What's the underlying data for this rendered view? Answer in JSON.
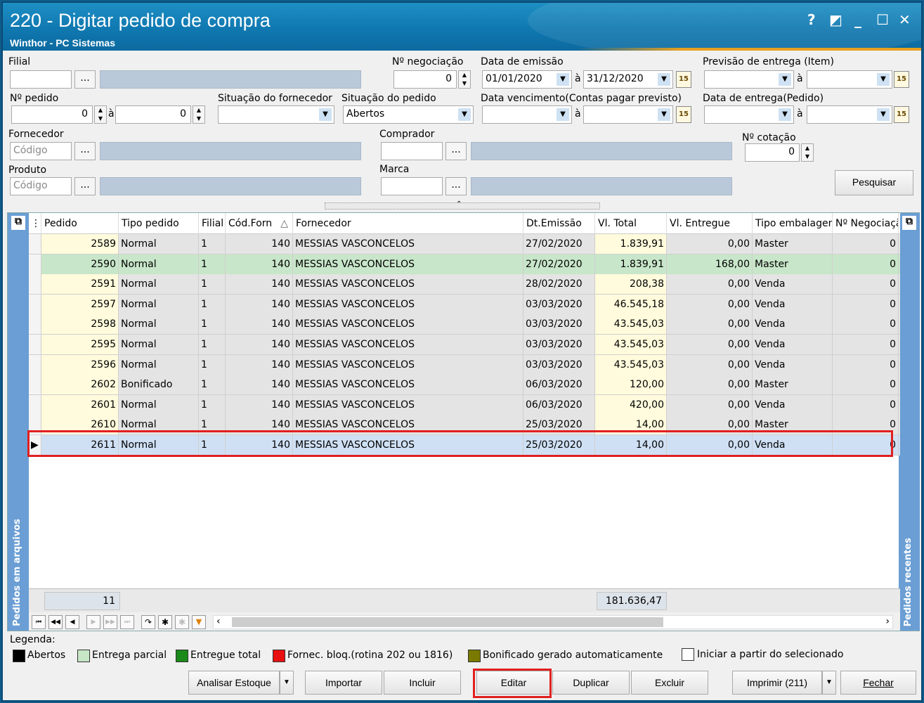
{
  "window": {
    "title": "220 - Digitar pedido de compra",
    "subtitle": "Winthor - PC Sistemas",
    "help": "?",
    "restore": "◩",
    "minimize": "_",
    "maximize": "☐",
    "close": "✕"
  },
  "filters": {
    "filial_label": "Filial",
    "ellipsis": "...",
    "negociacao_label": "Nº negociação",
    "negociacao_value": "0",
    "data_emissao_label": "Data de emissão",
    "data_emissao_from": "01/01/2020",
    "data_emissao_to": "31/12/2020",
    "a_label": "à",
    "previsao_label": "Previsão  de entrega (Item)",
    "pedido_label": "Nº pedido",
    "pedido_from": "0",
    "pedido_to": "0",
    "sit_fornecedor_label": "Situação do fornecedor",
    "sit_pedido_label": "Situação do pedido",
    "sit_pedido_value": "Abertos",
    "data_venc_label": "Data vencimento(Contas pagar previsto)",
    "data_entrega_label": "Data de entrega(Pedido)",
    "fornecedor_label": "Fornecedor",
    "codigo_placeholder": "Código",
    "comprador_label": "Comprador",
    "cotacao_label": "Nº cotação",
    "cotacao_value": "0",
    "produto_label": "Produto",
    "marca_label": "Marca",
    "pesquisar": "Pesquisar"
  },
  "grid": {
    "side_left": "Pedidos em arquivos",
    "side_right": "Pedidos recentes",
    "columns": [
      "Pedido",
      "Tipo pedido",
      "Filial",
      "Cód.Forn",
      "Fornecedor",
      "Dt.Emissão",
      "Vl. Total",
      "Vl. Entregue",
      "Tipo embalagem",
      "Nº Negociação"
    ],
    "sort_indicator": "△",
    "rows": [
      {
        "pedido": "2589",
        "tipo": "Normal",
        "filial": "1",
        "cod": "140",
        "fornecedor": "MESSIAS VASCONCELOS",
        "dt": "27/02/2020",
        "total": "1.839,91",
        "entregue": "0,00",
        "emb": "Master",
        "neg": "0"
      },
      {
        "pedido": "2590",
        "tipo": "Normal",
        "filial": "1",
        "cod": "140",
        "fornecedor": "MESSIAS VASCONCELOS",
        "dt": "27/02/2020",
        "total": "1.839,91",
        "entregue": "168,00",
        "emb": "Master",
        "neg": "0"
      },
      {
        "pedido": "2591",
        "tipo": "Normal",
        "filial": "1",
        "cod": "140",
        "fornecedor": "MESSIAS VASCONCELOS",
        "dt": "28/02/2020",
        "total": "208,38",
        "entregue": "0,00",
        "emb": "Venda",
        "neg": "0"
      },
      {
        "pedido": "2597",
        "tipo": "Normal",
        "filial": "1",
        "cod": "140",
        "fornecedor": "MESSIAS VASCONCELOS",
        "dt": "03/03/2020",
        "total": "46.545,18",
        "entregue": "0,00",
        "emb": "Venda",
        "neg": "0"
      },
      {
        "pedido": "2598",
        "tipo": "Normal",
        "filial": "1",
        "cod": "140",
        "fornecedor": "MESSIAS VASCONCELOS",
        "dt": "03/03/2020",
        "total": "43.545,03",
        "entregue": "0,00",
        "emb": "Venda",
        "neg": "0"
      },
      {
        "pedido": "2595",
        "tipo": "Normal",
        "filial": "1",
        "cod": "140",
        "fornecedor": "MESSIAS VASCONCELOS",
        "dt": "03/03/2020",
        "total": "43.545,03",
        "entregue": "0,00",
        "emb": "Venda",
        "neg": "0"
      },
      {
        "pedido": "2596",
        "tipo": "Normal",
        "filial": "1",
        "cod": "140",
        "fornecedor": "MESSIAS VASCONCELOS",
        "dt": "03/03/2020",
        "total": "43.545,03",
        "entregue": "0,00",
        "emb": "Venda",
        "neg": "0"
      },
      {
        "pedido": "2602",
        "tipo": "Bonificado",
        "filial": "1",
        "cod": "140",
        "fornecedor": "MESSIAS VASCONCELOS",
        "dt": "06/03/2020",
        "total": "120,00",
        "entregue": "0,00",
        "emb": "Master",
        "neg": "0"
      },
      {
        "pedido": "2601",
        "tipo": "Normal",
        "filial": "1",
        "cod": "140",
        "fornecedor": "MESSIAS VASCONCELOS",
        "dt": "06/03/2020",
        "total": "420,00",
        "entregue": "0,00",
        "emb": "Venda",
        "neg": "0"
      },
      {
        "pedido": "2610",
        "tipo": "Normal",
        "filial": "1",
        "cod": "140",
        "fornecedor": "MESSIAS VASCONCELOS",
        "dt": "25/03/2020",
        "total": "14,00",
        "entregue": "0,00",
        "emb": "Master",
        "neg": "0"
      },
      {
        "pedido": "2611",
        "tipo": "Normal",
        "filial": "1",
        "cod": "140",
        "fornecedor": "MESSIAS VASCONCELOS",
        "dt": "25/03/2020",
        "total": "14,00",
        "entregue": "0,00",
        "emb": "Venda",
        "neg": "0"
      }
    ],
    "row_count": "11",
    "total_sum": "181.636,47",
    "scroll_left": "‹",
    "scroll_right": "›"
  },
  "legend": {
    "title": "Legenda:",
    "items": [
      {
        "label": "Abertos",
        "color": "#000000"
      },
      {
        "label": "Entrega parcial",
        "color": "#c6e6c6"
      },
      {
        "label": "Entregue total",
        "color": "#1a8a1a"
      },
      {
        "label": "Fornec. bloq.(rotina 202 ou 1816)",
        "color": "#e81010"
      },
      {
        "label": "Bonificado gerado automaticamente",
        "color": "#7a7a00"
      }
    ],
    "iniciar": "Iniciar a partir do selecionado"
  },
  "buttons": {
    "analisar": "Analisar Estoque",
    "importar": "Importar",
    "incluir": "Incluir",
    "editar": "Editar",
    "duplicar": "Duplicar",
    "excluir": "Excluir",
    "imprimir": "Imprimir (211)",
    "fechar": "Fechar"
  },
  "colors": {
    "highlight": "#e02020",
    "row_selected": "#cfe0f4",
    "row_partial": "#c8e6c9",
    "pedido_col": "#fffbdc"
  }
}
